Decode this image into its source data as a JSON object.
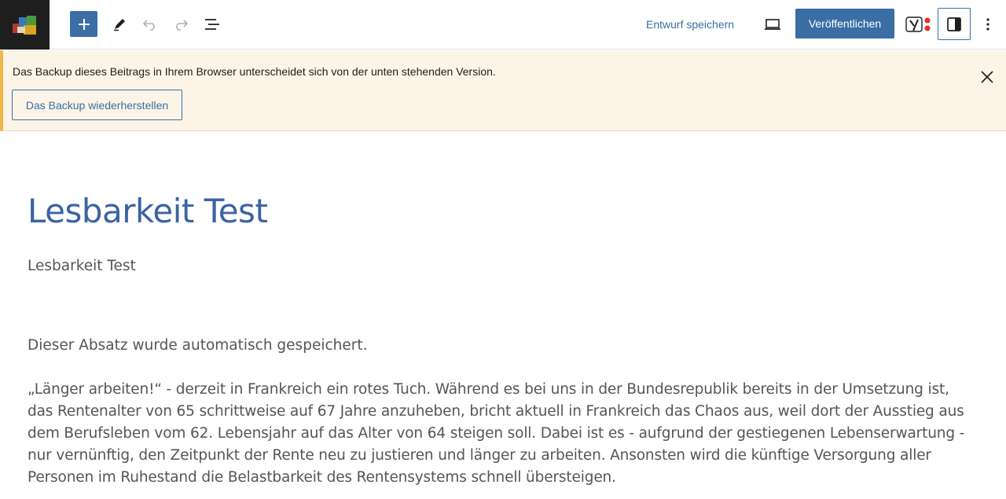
{
  "toolbar": {
    "site_logo": "site-logo-icon",
    "inserter_icon": "plus-icon",
    "tools_icon": "pen-icon",
    "undo_icon": "undo-icon",
    "redo_icon": "redo-icon",
    "list_view_icon": "list-view-icon",
    "save_draft_label": "Entwurf speichern",
    "preview_icon": "laptop-icon",
    "publish_label": "Veröffentlichen",
    "yoast_icon": "yoast-icon",
    "settings_icon": "sidebar-toggle-icon",
    "more_icon": "more-vertical-icon",
    "accent_color": "#3a6ea5"
  },
  "notice": {
    "message": "Das Backup dieses Beitrags in Ihrem Browser unterscheidet sich von der unten stehenden Version.",
    "restore_label": "Das Backup wiederherstellen",
    "close_icon": "close-icon",
    "border_color": "#f0b849",
    "background_color": "#fcf4e6"
  },
  "editor": {
    "title": "Lesbarkeit Test",
    "paragraphs": [
      "Lesbarkeit Test",
      "Dieser Absatz wurde automatisch gespeichert.",
      "„Länger arbeiten!“ - derzeit in Frankreich ein rotes Tuch. Während es bei uns in der Bundesrepublik bereits in der Umsetzung ist, das Rentenalter von 65 schrittweise auf 67 Jahre anzuheben, bricht aktuell in Frankreich das Chaos aus, weil dort der Ausstieg aus dem Berufsleben vom 62. Lebensjahr auf das Alter von 64 steigen soll. Dabei ist es - aufgrund der gestiegenen Lebenserwartung - nur vernünftig, den Zeitpunkt der Rente neu zu justieren und länger zu arbeiten. Ansonsten wird die künftige Versorgung aller Personen im Ruhestand die Belastbarkeit des Rentensystems schnell übersteigen."
    ],
    "title_color": "#3a63a5"
  }
}
